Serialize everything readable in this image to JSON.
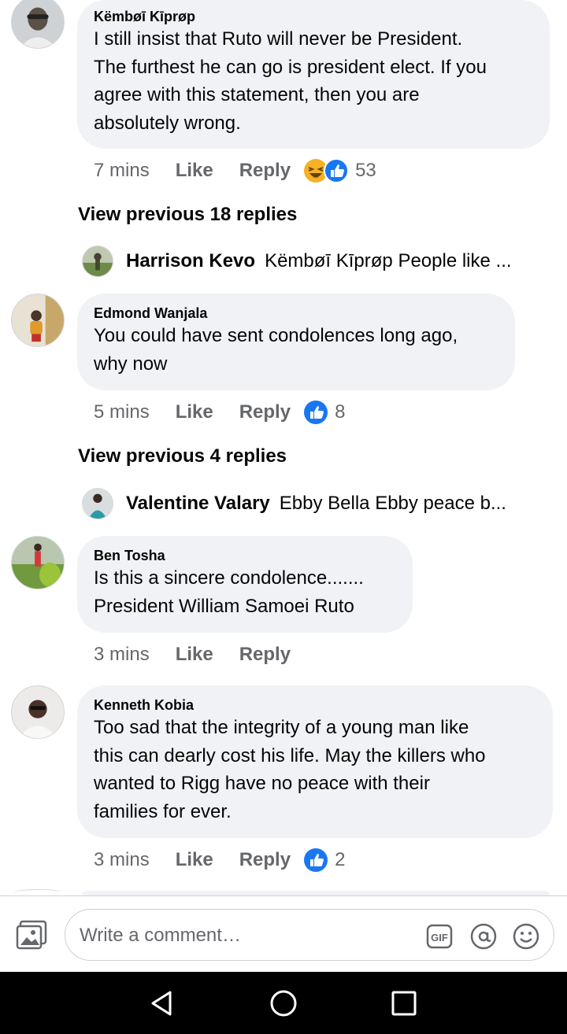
{
  "comments": [
    {
      "author": "Këmbøī Kīprøp",
      "text": "I still insist that Ruto will never be President.\nThe furthest he can go is president elect. If you\nagree with this statement, then you are\nabsolutely wrong.",
      "time": "7 mins",
      "like_label": "Like",
      "reply_label": "Reply",
      "reactions": [
        "haha-icon",
        "like-icon"
      ],
      "reaction_count": "53"
    },
    {
      "author": "Edmond Wanjala",
      "text": "You could have sent condolences long ago,\nwhy now",
      "time": "5 mins",
      "like_label": "Like",
      "reply_label": "Reply",
      "reactions": [
        "like-icon"
      ],
      "reaction_count": "8"
    },
    {
      "author": "Ben Tosha",
      "text": "Is this a sincere condolence.......\nPresident William Samoei Ruto",
      "time": "3 mins",
      "like_label": "Like",
      "reply_label": "Reply"
    },
    {
      "author": "Kenneth Kobia",
      "text": "Too sad that the integrity of a young man like\nthis can dearly cost his life. May the killers who\nwanted to Rigg have no peace with their\nfamilies for ever.",
      "time": "3 mins",
      "like_label": "Like",
      "reply_label": "Reply",
      "reactions": [
        "like-icon"
      ],
      "reaction_count": "2"
    }
  ],
  "view_previous": [
    "View previous 18 replies",
    "View previous 4 replies"
  ],
  "reply_previews": [
    {
      "name": "Harrison Kevo",
      "text": "Këmbøī Kīprøp People like ..."
    },
    {
      "name": "Valentine Valary",
      "text": "Ebby Bella Ebby peace  b..."
    }
  ],
  "composer": {
    "placeholder": "Write a comment…",
    "gif_label": "GIF"
  },
  "navbar": [
    "back-icon",
    "home-icon",
    "recents-icon"
  ],
  "colors": {
    "bubble": "#f0f2f5",
    "meta_text": "#65676b",
    "like_blue": "#1877f2",
    "haha_yellow": "#f7b125",
    "navbar": "#000000"
  }
}
